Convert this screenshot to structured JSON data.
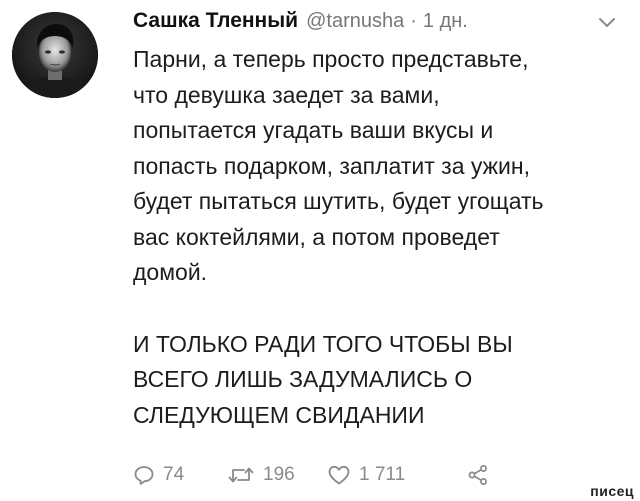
{
  "tweet": {
    "author": {
      "display_name": "Сашка Тленный",
      "handle": "@tarnusha",
      "separator": "·",
      "time": "1 дн."
    },
    "paragraphs": [
      "Парни, а теперь просто представьте,\nчто девушка заедет за вами,\nпопытается угадать ваши вкусы и\nпопасть подарком, заплатит за ужин,\nбудет пытаться шутить, будет угощать\nвас коктейлями, а потом проведет\nдомой.",
      "И ТОЛЬКО РАДИ ТОГО ЧТОБЫ ВЫ\nВСЕГО ЛИШЬ ЗАДУМАЛИСЬ О\nСЛЕДУЮЩЕМ СВИДАНИИ"
    ],
    "actions": {
      "reply_count": "74",
      "retweet_count": "196",
      "like_count": "1 711"
    },
    "icons": {
      "menu": "chevron-down-icon",
      "reply": "reply-icon",
      "retweet": "retweet-icon",
      "like": "heart-icon",
      "share": "share-icon"
    }
  },
  "watermark": "писец",
  "colors": {
    "text": "#1d1d1d",
    "muted": "#777777",
    "background": "#ffffff"
  }
}
